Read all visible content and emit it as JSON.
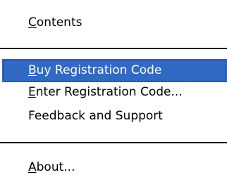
{
  "menu": {
    "items": [
      {
        "mnemonic": "C",
        "rest": "ontents"
      },
      {
        "mnemonic": "B",
        "rest": "uy Registration Code"
      },
      {
        "mnemonic": "E",
        "rest": "nter Registration Code..."
      },
      {
        "mnemonic": "",
        "rest": "Feedback and Support"
      },
      {
        "mnemonic": "A",
        "rest": "bout..."
      }
    ],
    "selected_index": 1
  },
  "colors": {
    "highlight": "#316ac5",
    "highlight_text": "#ffffff",
    "text": "#000000",
    "background": "#ffffff"
  }
}
